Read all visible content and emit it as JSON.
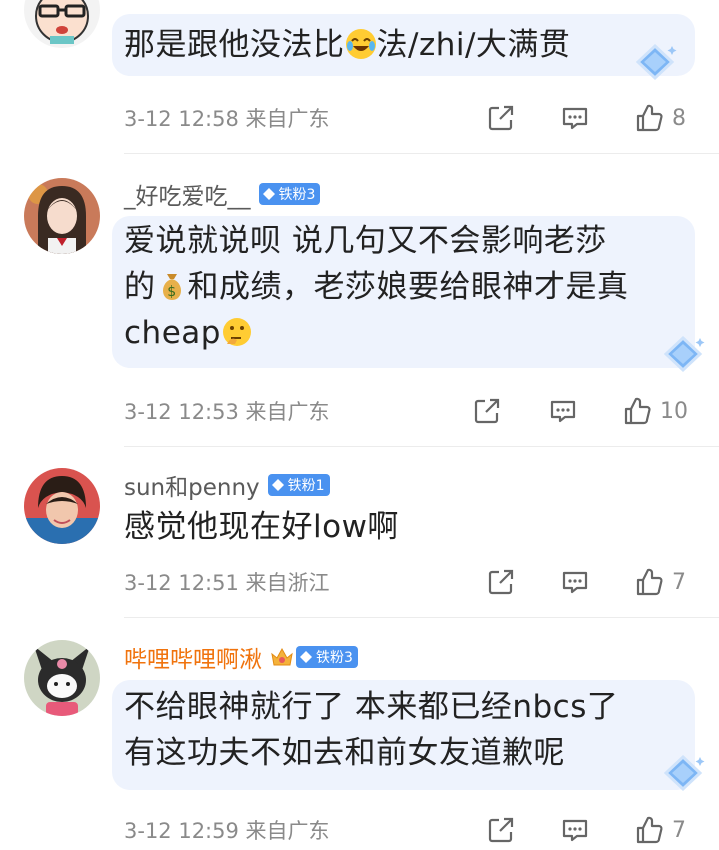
{
  "comments": [
    {
      "username": "",
      "text_parts": [
        "那是跟他没法比",
        "法/zhi/大满贯"
      ],
      "emoji": "laughing-crying-emoji",
      "time": "3-12 12:58",
      "location": "来自广东",
      "likes": "8",
      "bubble_highlight": true
    },
    {
      "username": "_好吃爱吃__",
      "badge": "铁粉3",
      "text_line1": "爱说就说呗 说几句又不会影响老莎",
      "text_line2a": "的",
      "text_line2b": "和成绩，老莎娘要给眼神才是真",
      "text_line3": "cheap",
      "emoji1": "money-bag-emoji",
      "emoji2": "thinking-face-emoji",
      "time": "3-12 12:53",
      "location": "来自广东",
      "likes": "10",
      "bubble_highlight": true
    },
    {
      "username": "sun和penny",
      "badge": "铁粉1",
      "text": "感觉他现在好low啊",
      "time": "3-12 12:51",
      "location": "来自浙江",
      "likes": "7",
      "bubble_highlight": false
    },
    {
      "username": "哔哩哔哩啊湫",
      "badge": "铁粉3",
      "text_line1": "不给眼神就行了 本来都已经nbcs了",
      "text_line2": "有这功夫不如去和前女友道歉呢",
      "time": "3-12 12:59",
      "location": "来自广东",
      "likes": "7",
      "bubble_highlight": true
    }
  ],
  "colors": {
    "bubble": "#eef3fd",
    "badge": "#4a92f0",
    "vip_name": "#f0730d",
    "meta_text": "#8a8a8a"
  }
}
